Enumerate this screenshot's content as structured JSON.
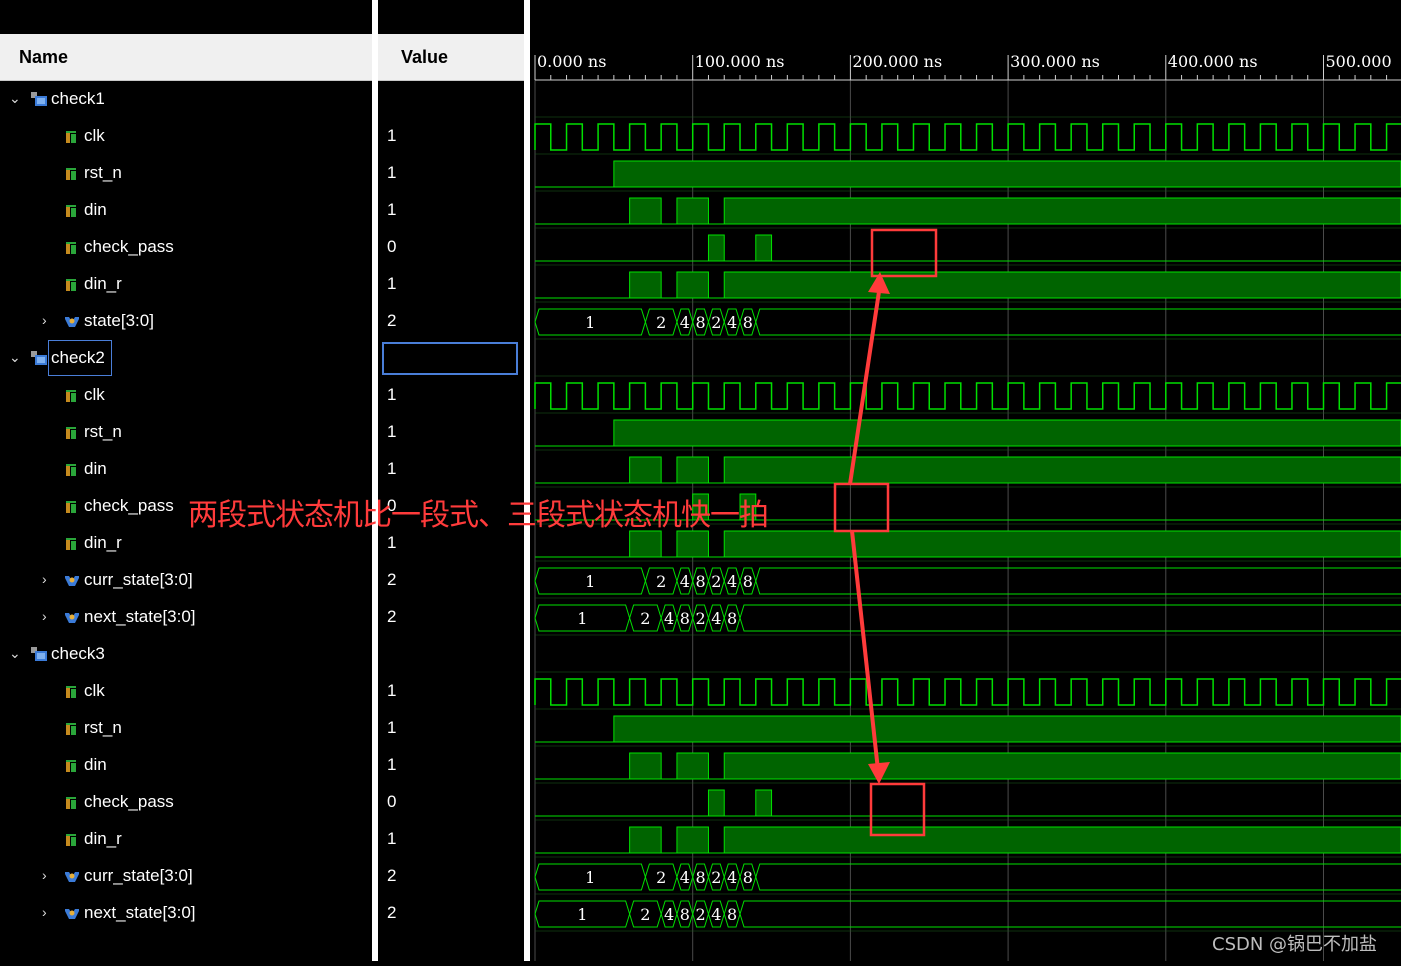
{
  "headers": {
    "name": "Name",
    "value": "Value"
  },
  "timeline": {
    "ticks": [
      "0.000 ns",
      "100.000 ns",
      "200.000 ns",
      "300.000 ns",
      "400.000 ns",
      "500.000"
    ]
  },
  "groups": [
    {
      "label": "check1",
      "signals": [
        {
          "label": "clk",
          "value": "1"
        },
        {
          "label": "rst_n",
          "value": "1"
        },
        {
          "label": "din",
          "value": "1"
        },
        {
          "label": "check_pass",
          "value": "0"
        },
        {
          "label": "din_r",
          "value": "1"
        },
        {
          "label": "state[3:0]",
          "value": "2",
          "bus": true
        }
      ]
    },
    {
      "label": "check2",
      "signals": [
        {
          "label": "clk",
          "value": "1"
        },
        {
          "label": "rst_n",
          "value": "1"
        },
        {
          "label": "din",
          "value": "1"
        },
        {
          "label": "check_pass",
          "value": "0"
        },
        {
          "label": "din_r",
          "value": "1"
        },
        {
          "label": "curr_state[3:0]",
          "value": "2",
          "bus": true
        },
        {
          "label": "next_state[3:0]",
          "value": "2",
          "bus": true
        }
      ]
    },
    {
      "label": "check3",
      "signals": [
        {
          "label": "clk",
          "value": "1"
        },
        {
          "label": "rst_n",
          "value": "1"
        },
        {
          "label": "din",
          "value": "1"
        },
        {
          "label": "check_pass",
          "value": "0"
        },
        {
          "label": "din_r",
          "value": "1"
        },
        {
          "label": "curr_state[3:0]",
          "value": "2",
          "bus": true
        },
        {
          "label": "next_state[3:0]",
          "value": "2",
          "bus": true
        }
      ]
    }
  ],
  "bus_values": {
    "curr": [
      "1",
      "2",
      "4",
      "8",
      "2",
      "4",
      "8"
    ],
    "next": [
      "1",
      "2",
      "4",
      "8",
      "2",
      "4",
      "8"
    ]
  },
  "annotation": "两段式状态机比一段式、三段式状态机快一拍",
  "watermark": "CSDN @锅巴不加盐",
  "colors": {
    "wave": "#00e000",
    "fill": "#006400",
    "highlight": "#ff3b3b",
    "header_bg": "#f0f0f0"
  }
}
